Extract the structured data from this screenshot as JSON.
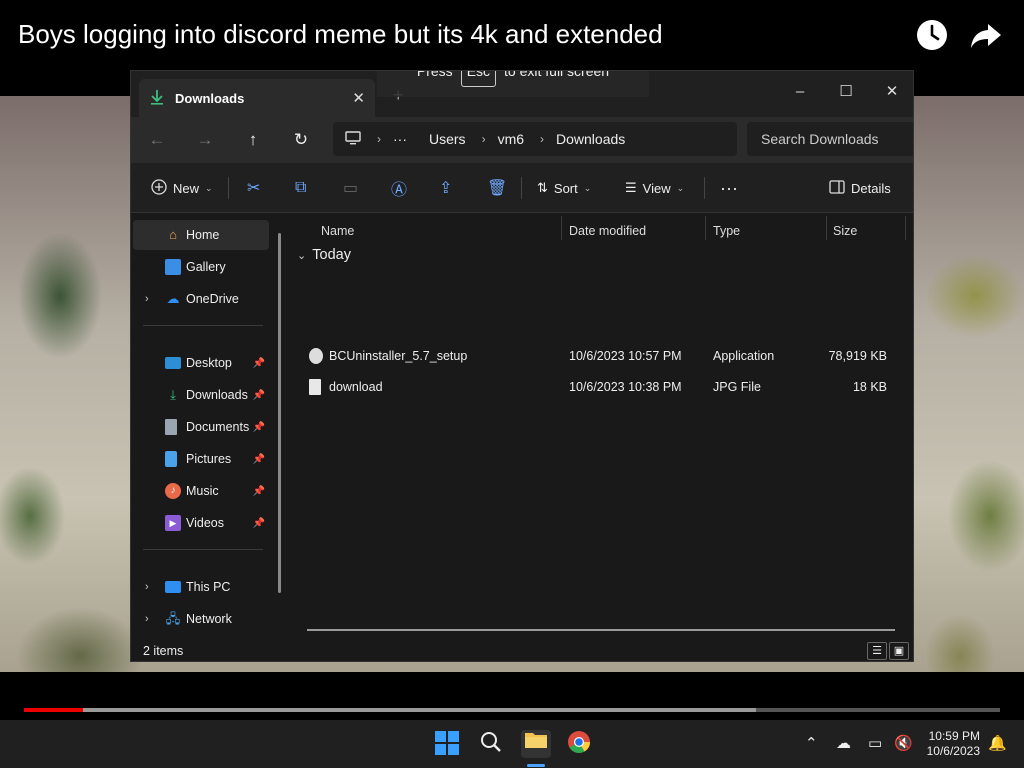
{
  "video": {
    "title": "Boys logging into discord meme but its 4k and extended",
    "watch_later_icon": "clock-icon",
    "share_icon": "share-arrow-icon",
    "fullscreen_hint_before": "Press",
    "fullscreen_hint_key": "Esc",
    "fullscreen_hint_after": "to exit full screen",
    "progress_played_fraction": 0.06,
    "progress_buffered_fraction": 0.75
  },
  "explorer": {
    "tab_label": "Downloads",
    "window_controls": [
      "–",
      "☐",
      "✕"
    ],
    "breadcrumb": [
      "Users",
      "vm6",
      "Downloads"
    ],
    "breadcrumb_more": "···",
    "search_placeholder": "Search Downloads",
    "commands": {
      "new": "New",
      "sort": "Sort",
      "view": "View",
      "details": "Details"
    },
    "sidebar": {
      "home": "Home",
      "gallery": "Gallery",
      "onedrive": "OneDrive",
      "desktop": "Desktop",
      "downloads": "Downloads",
      "documents": "Documents",
      "pictures": "Pictures",
      "music": "Music",
      "videos": "Videos",
      "thispc": "This PC",
      "network": "Network"
    },
    "columns": {
      "name": "Name",
      "date": "Date modified",
      "type": "Type",
      "size": "Size"
    },
    "group": "Today",
    "files": [
      {
        "name": "BCUninstaller_5.7_setup",
        "date": "10/6/2023 10:57 PM",
        "type": "Application",
        "size": "78,919 KB"
      },
      {
        "name": "download",
        "date": "10/6/2023 10:38 PM",
        "type": "JPG File",
        "size": "18 KB"
      }
    ],
    "status": "2 items"
  },
  "taskbar": {
    "time": "10:59 PM",
    "date": "10/6/2023"
  },
  "colors": {
    "accent": "#4da3ff",
    "progress_red": "#ff0000",
    "folder_yellow": "#f2c14e",
    "download_green": "#3fbf7f"
  }
}
